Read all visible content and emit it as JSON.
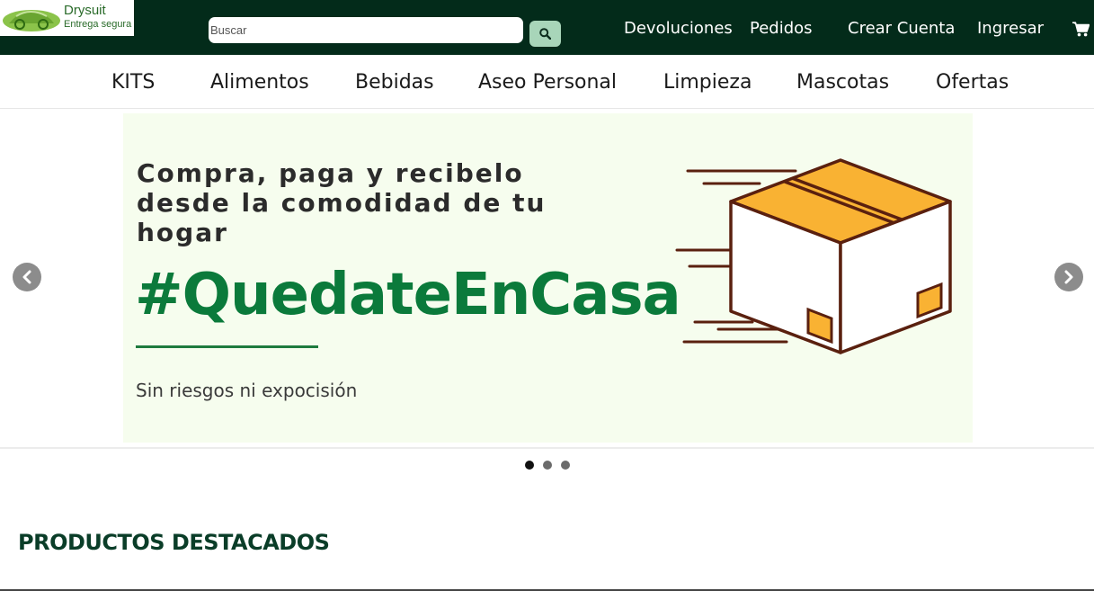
{
  "header": {
    "logo": {
      "name": "Drysuit",
      "tagline": "Entrega segura"
    },
    "search": {
      "placeholder": "Buscar",
      "value": ""
    },
    "links": {
      "returns": "Devoluciones",
      "orders": "Pedidos",
      "create_account": "Crear Cuenta",
      "login": "Ingresar"
    },
    "icons": {
      "search": "search-icon",
      "cart": "shopping-cart-icon"
    },
    "colors": {
      "bar": "#032b1a",
      "search_button": "#a8d5b9"
    }
  },
  "categories": [
    {
      "label": "KITS"
    },
    {
      "label": "Alimentos"
    },
    {
      "label": "Bebidas"
    },
    {
      "label": "Aseo Personal"
    },
    {
      "label": "Limpieza"
    },
    {
      "label": "Mascotas"
    },
    {
      "label": "Ofertas"
    }
  ],
  "carousel": {
    "slide": {
      "headline": "Compra, paga y recibelo desde la comodidad de tu hogar",
      "hashtag": "#QuedateEnCasa",
      "subtext": "Sin riesgos ni expocisión",
      "image": "delivery-box-illustration"
    },
    "indicators": {
      "count": 3,
      "active_index": 0
    },
    "icons": {
      "prev": "chevron-left-icon",
      "next": "chevron-right-icon"
    },
    "colors": {
      "slide_bg": "#f6fdee",
      "hashtag": "#0b7a3b",
      "box": "#f9b233",
      "outline": "#5a200f"
    }
  },
  "sections": {
    "featured_title": "PRODUCTOS DESTACADOS"
  }
}
